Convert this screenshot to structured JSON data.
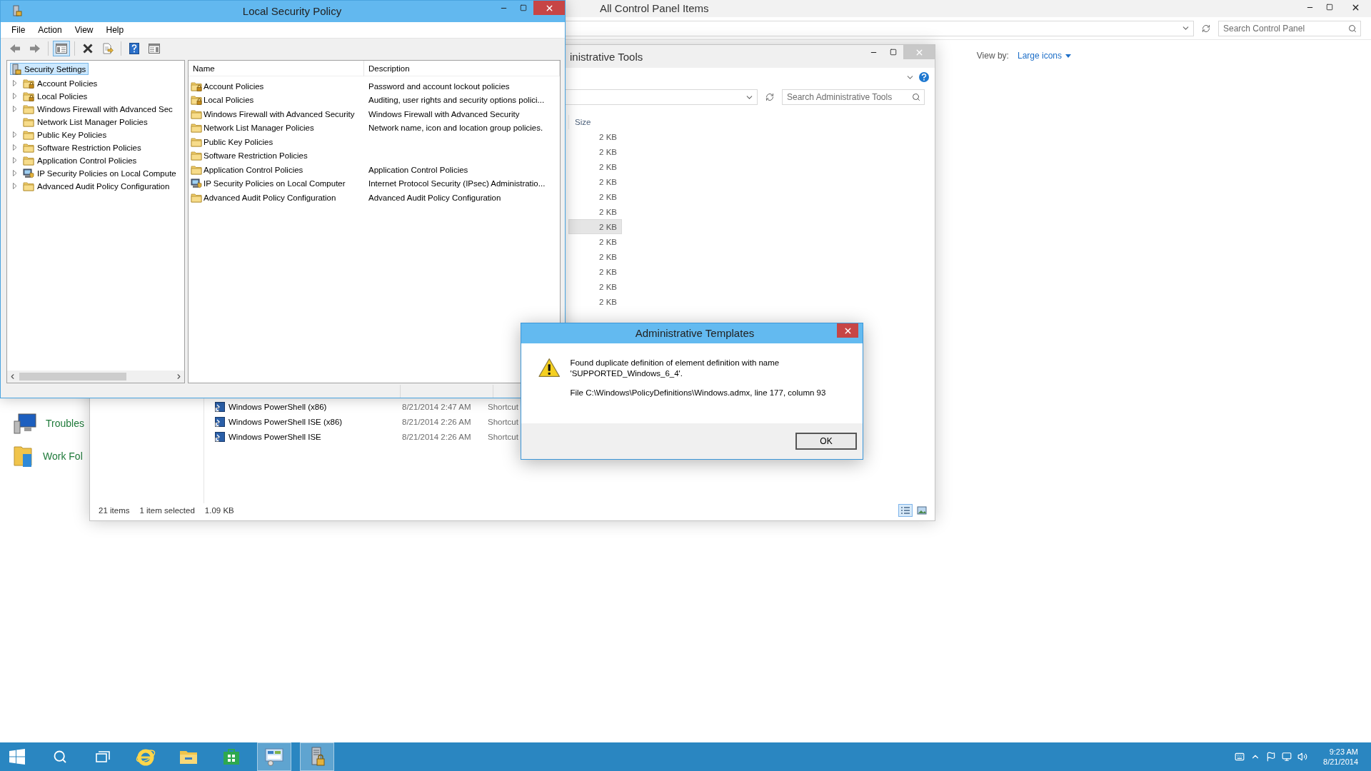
{
  "control_panel": {
    "title": "All Control Panel Items",
    "search": {
      "placeholder": "Search Control Panel"
    },
    "view_by": {
      "label": "View by:",
      "value": "Large icons"
    },
    "items": [
      {
        "label": "Troubles",
        "kind": "troubleshooting"
      },
      {
        "label": "Work Fol",
        "kind": "work-folders"
      }
    ]
  },
  "admin_tools": {
    "title": "inistrative Tools",
    "search": {
      "placeholder": "Search Administrative Tools"
    },
    "size_column": {
      "header": "Size",
      "cells": [
        {
          "text": "2 KB",
          "selected": false
        },
        {
          "text": "2 KB",
          "selected": false
        },
        {
          "text": "2 KB",
          "selected": false
        },
        {
          "text": "2 KB",
          "selected": false
        },
        {
          "text": "2 KB",
          "selected": false
        },
        {
          "text": "2 KB",
          "selected": false
        },
        {
          "text": "2 KB",
          "selected": true
        },
        {
          "text": "2 KB",
          "selected": false
        },
        {
          "text": "2 KB",
          "selected": false
        },
        {
          "text": "2 KB",
          "selected": false
        },
        {
          "text": "2 KB",
          "selected": false
        },
        {
          "text": "2 KB",
          "selected": false
        }
      ]
    },
    "rows": [
      {
        "name": "Windows PowerShell (x86)",
        "date": "8/21/2014 2:47 AM",
        "type": "Shortcut"
      },
      {
        "name": "Windows PowerShell ISE (x86)",
        "date": "8/21/2014 2:26 AM",
        "type": "Shortcut"
      },
      {
        "name": "Windows PowerShell ISE",
        "date": "8/21/2014 2:26 AM",
        "type": "Shortcut"
      }
    ],
    "status": {
      "count": "21 items",
      "selection": "1 item selected",
      "size": "1.09 KB"
    },
    "views": [
      {
        "kind": "details",
        "selected": true
      },
      {
        "kind": "large-icons",
        "selected": false
      }
    ]
  },
  "local_security_policy": {
    "title": "Local Security Policy",
    "menu": [
      "File",
      "Action",
      "View",
      "Help"
    ],
    "toolbar": [
      {
        "kind": "back",
        "pressed": false
      },
      {
        "kind": "forward",
        "pressed": false
      },
      {
        "kind": "console-tree",
        "pressed": true
      },
      {
        "kind": "delete",
        "pressed": false
      },
      {
        "kind": "export",
        "pressed": false
      },
      {
        "kind": "help",
        "pressed": false
      },
      {
        "kind": "action-pane",
        "pressed": false
      }
    ],
    "tree": {
      "label": "Security Settings",
      "selected": true,
      "children": [
        {
          "label": "Account Policies",
          "kind": "lock-folder",
          "expandable": true
        },
        {
          "label": "Local Policies",
          "kind": "lock-folder",
          "expandable": true
        },
        {
          "label": "Windows Firewall with Advanced Sec",
          "kind": "folder",
          "expandable": true
        },
        {
          "label": "Network List Manager Policies",
          "kind": "folder",
          "expandable": false
        },
        {
          "label": "Public Key Policies",
          "kind": "folder",
          "expandable": true
        },
        {
          "label": "Software Restriction Policies",
          "kind": "folder",
          "expandable": true
        },
        {
          "label": "Application Control Policies",
          "kind": "folder",
          "expandable": true
        },
        {
          "label": "IP Security Policies on Local Compute",
          "kind": "computer",
          "expandable": true
        },
        {
          "label": "Advanced Audit Policy Configuration",
          "kind": "folder",
          "expandable": true
        }
      ]
    },
    "list": {
      "columns": [
        "Name",
        "Description"
      ],
      "rows": [
        {
          "name": "Account Policies",
          "description": "Password and account lockout policies",
          "kind": "lock-folder"
        },
        {
          "name": "Local Policies",
          "description": "Auditing, user rights and security options polici...",
          "kind": "lock-folder"
        },
        {
          "name": "Windows Firewall with Advanced Security",
          "description": "Windows Firewall with Advanced Security",
          "kind": "folder"
        },
        {
          "name": "Network List Manager Policies",
          "description": "Network name, icon and location group policies.",
          "kind": "folder"
        },
        {
          "name": "Public Key Policies",
          "kind": "folder"
        },
        {
          "name": "Software Restriction Policies",
          "kind": "folder"
        },
        {
          "name": "Application Control Policies",
          "description": "Application Control Policies",
          "kind": "folder"
        },
        {
          "name": "IP Security Policies on Local Computer",
          "description": "Internet Protocol Security (IPsec) Administratio...",
          "kind": "computer"
        },
        {
          "name": "Advanced Audit Policy Configuration",
          "description": "Advanced Audit Policy Configuration",
          "kind": "folder"
        }
      ]
    }
  },
  "dialog": {
    "title": "Administrative Templates",
    "message": "Found duplicate definition of element definition with name 'SUPPORTED_Windows_6_4'.",
    "detail": "File C:\\Windows\\PolicyDefinitions\\Windows.admx, line 177, column 93",
    "button": "OK"
  },
  "taskbar": {
    "buttons": [
      {
        "kind": "start",
        "active": false
      },
      {
        "kind": "search",
        "active": false
      },
      {
        "kind": "task-view",
        "active": false
      },
      {
        "kind": "browser",
        "active": false
      },
      {
        "kind": "file-explorer",
        "active": false
      },
      {
        "kind": "store",
        "active": false
      },
      {
        "kind": "control-panel",
        "active": true
      },
      {
        "kind": "security-policy",
        "active": true
      }
    ],
    "clock": {
      "time": "9:23 AM",
      "date": "8/21/2014"
    }
  }
}
